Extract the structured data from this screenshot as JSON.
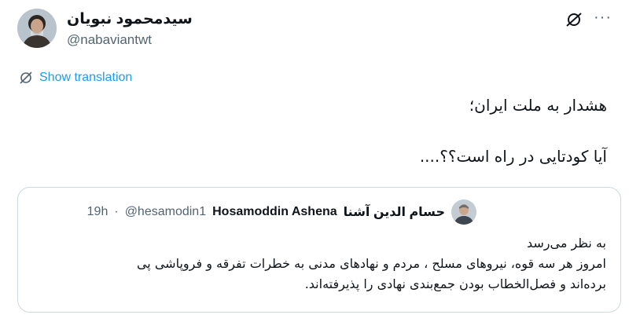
{
  "header": {
    "display_name": "سیدمحمود نبویان",
    "handle": "@nabaviantwt",
    "avatar_icon": "avatar-photo",
    "action_icons": [
      "grok-icon",
      "more-icon"
    ],
    "more_label": "···"
  },
  "translation": {
    "label": "Show translation",
    "icon": "translate-icon"
  },
  "tweet": {
    "line1": "هشدار به ملت ایران؛",
    "line2": "آیا کودتایی در راه است؟؟...."
  },
  "quote": {
    "author_name": "Hosamoddin Ashena",
    "author_name_fa": "حسام الدین آشنا",
    "handle": "@hesamodin1",
    "separator": "·",
    "time": "19h",
    "text_line1": "به نظر می‌رسد",
    "text_line2": "امروز هر سه قوه، نیروهای مسلح ، مردم و نهادهای مدنی به خطرات تفرقه و فروپاشی پی",
    "text_line3": "برده‌اند و  فصل‌الخطاب بودن جمع‌بندی نهادی را پذیرفته‌اند."
  },
  "colors": {
    "text": "#0f1419",
    "muted": "#536471",
    "link": "#1d9bf0",
    "border": "#cfd9de"
  }
}
